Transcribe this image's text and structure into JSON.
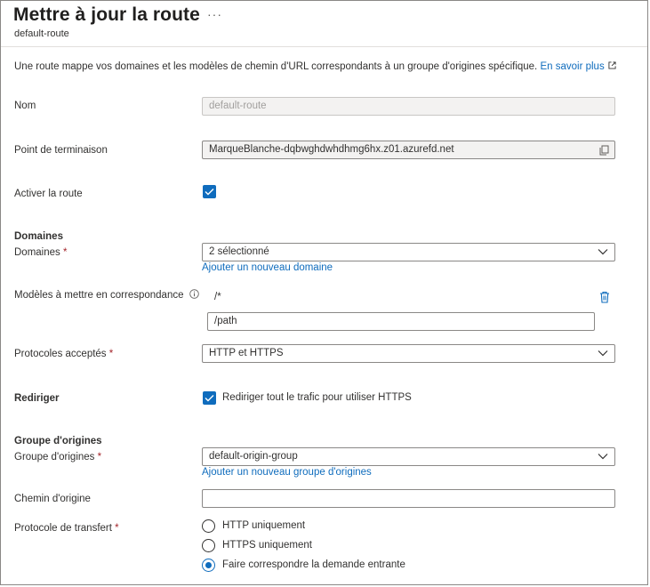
{
  "header": {
    "title": "Mettre à jour la route",
    "more_label": "···",
    "subtitle": "default-route"
  },
  "description": {
    "text": "Une route mappe vos domaines et les modèles de chemin d'URL correspondants à un groupe d'origines spécifique.",
    "link": "En savoir plus"
  },
  "form": {
    "name": {
      "label": "Nom",
      "value": "default-route"
    },
    "endpoint": {
      "label": "Point de terminaison",
      "value": "MarqueBlanche-dqbwghdwhdhmg6hx.z01.azurefd.net"
    },
    "enable_route": {
      "label": "Activer la route",
      "checked": true
    },
    "domains_section": "Domaines",
    "domains": {
      "label": "Domaines",
      "required": "*",
      "value": "2 sélectionné",
      "add_link": "Ajouter un nouveau domaine"
    },
    "patterns": {
      "label": "Modèles à mettre en correspondance",
      "items": [
        "/*"
      ],
      "new_value": "/path"
    },
    "protocols": {
      "label": "Protocoles acceptés",
      "required": "*",
      "value": "HTTP et HTTPS"
    },
    "redirect": {
      "label": "Rediriger",
      "checkbox_label": "Rediriger tout le trafic pour utiliser HTTPS",
      "checked": true
    },
    "origin_section": "Groupe d'origines",
    "origin_group": {
      "label": "Groupe d'origines",
      "required": "*",
      "value": "default-origin-group",
      "add_link": "Ajouter un nouveau groupe d'origines"
    },
    "origin_path": {
      "label": "Chemin d'origine",
      "value": ""
    },
    "forwarding": {
      "label": "Protocole de transfert",
      "required": "*",
      "options": [
        "HTTP uniquement",
        "HTTPS uniquement",
        "Faire correspondre la demande entrante"
      ],
      "selected": "Faire correspondre la demande entrante"
    }
  },
  "colors": {
    "accent": "#0f6cbd",
    "required": "#a4262c"
  }
}
